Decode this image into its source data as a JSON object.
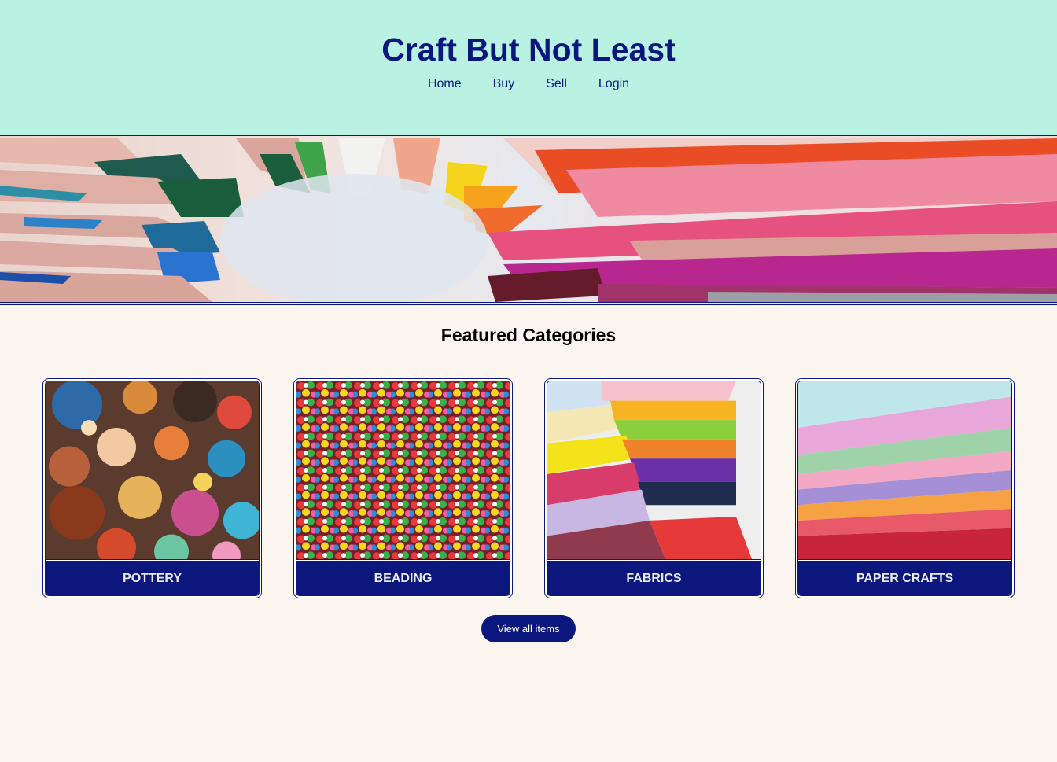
{
  "header": {
    "title": "Craft But Not Least",
    "nav": [
      {
        "label": "Home"
      },
      {
        "label": "Buy"
      },
      {
        "label": "Sell"
      },
      {
        "label": "Login"
      }
    ]
  },
  "hero": {
    "image": "colored-pencils-banner"
  },
  "featured": {
    "title": "Featured Categories",
    "categories": [
      {
        "label": "POTTERY",
        "image": "pottery-photo"
      },
      {
        "label": "BEADING",
        "image": "beads-photo"
      },
      {
        "label": "FABRICS",
        "image": "fabrics-photo"
      },
      {
        "label": "PAPER CRAFTS",
        "image": "paper-photo"
      }
    ],
    "view_all_label": "View all items"
  },
  "colors": {
    "header_bg": "#b9f2e3",
    "brand": "#0b177d",
    "page_bg": "#faf6ef"
  }
}
